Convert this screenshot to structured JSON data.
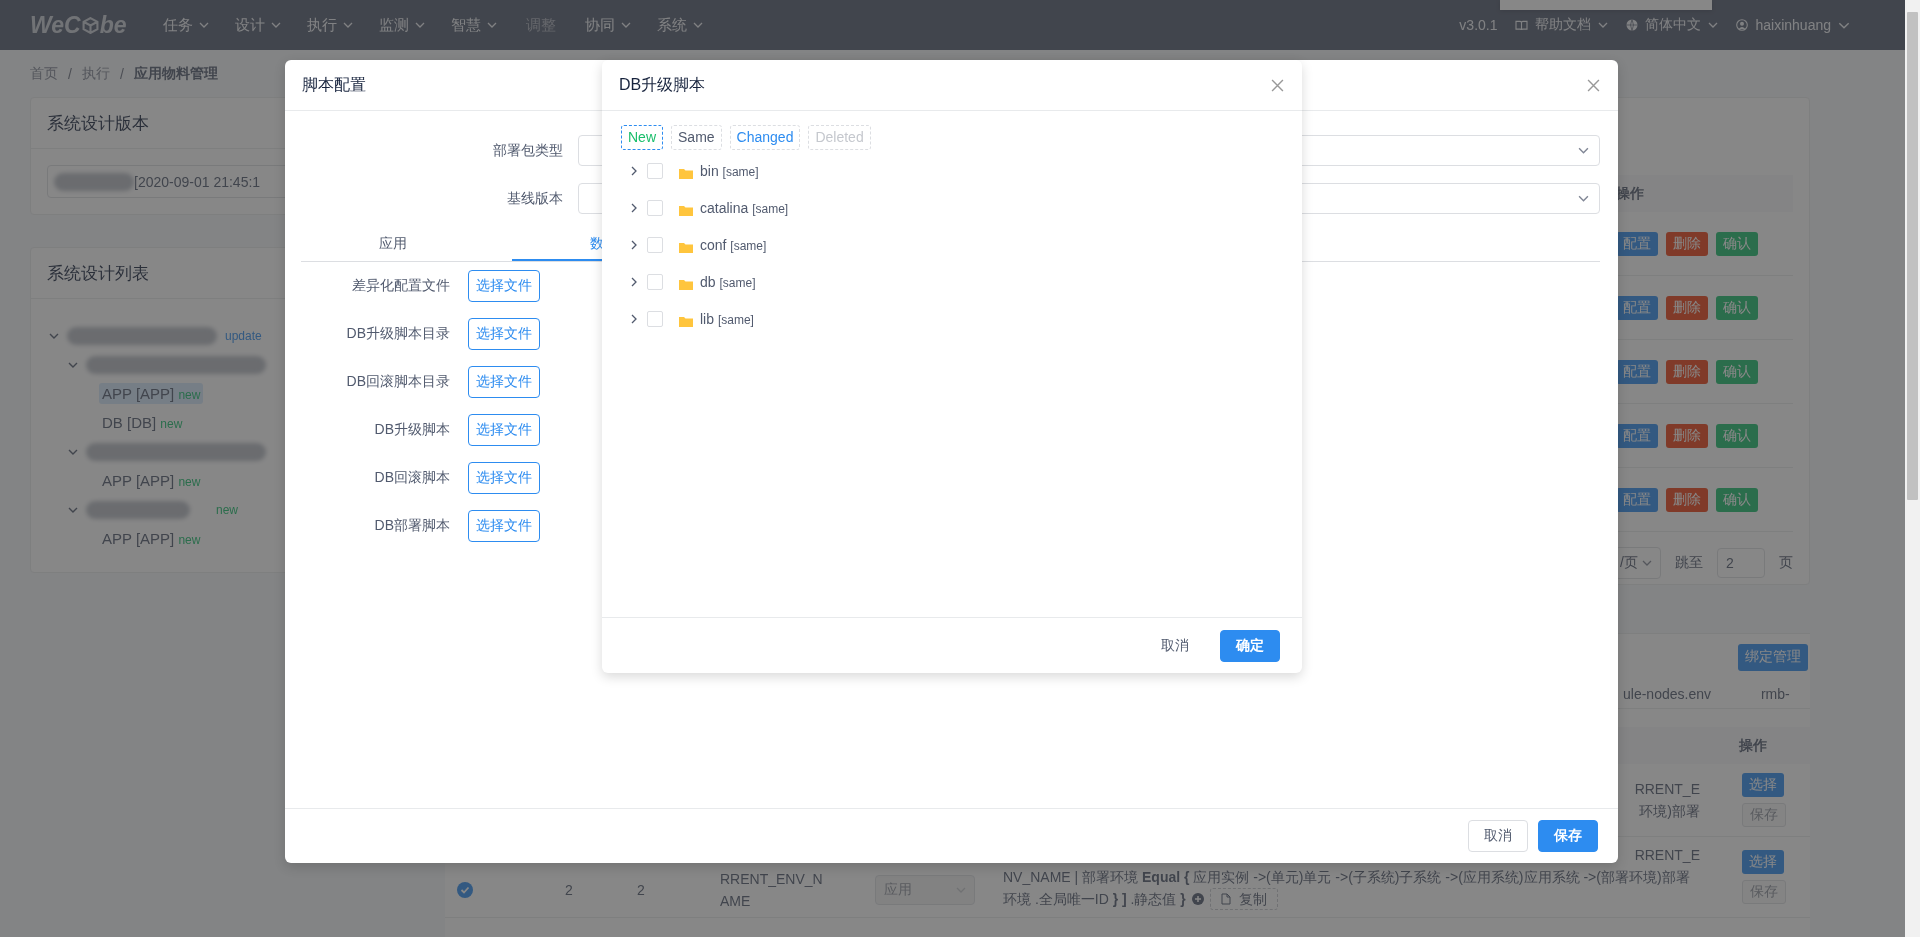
{
  "header": {
    "logo_start": "WeC",
    "logo_end": "be",
    "menu": [
      {
        "label": "任务",
        "dropdown": true,
        "disabled": false
      },
      {
        "label": "设计",
        "dropdown": true,
        "disabled": false
      },
      {
        "label": "执行",
        "dropdown": true,
        "disabled": false
      },
      {
        "label": "监测",
        "dropdown": true,
        "disabled": false
      },
      {
        "label": "智慧",
        "dropdown": true,
        "disabled": false
      },
      {
        "label": "调整",
        "dropdown": false,
        "disabled": true
      },
      {
        "label": "协同",
        "dropdown": true,
        "disabled": false
      },
      {
        "label": "系统",
        "dropdown": true,
        "disabled": false
      }
    ],
    "version": "v3.0.1",
    "help": "帮助文档",
    "language": "简体中文",
    "user": "haixinhuang"
  },
  "breadcrumb": [
    {
      "label": "首页",
      "current": false
    },
    {
      "label": "执行",
      "current": false
    },
    {
      "label": "应用物料管理",
      "current": true
    }
  ],
  "breadcrumb_separator": "/",
  "version_card": {
    "title": "系统设计版本",
    "value": "[2020-09-01 21:45:1"
  },
  "design_list": {
    "title": "系统设计列表",
    "tree": [
      {
        "kind": "redacted",
        "tag": "update",
        "color": "#335981",
        "expanded": true,
        "children": [
          {
            "kind": "redacted",
            "expanded": true,
            "children": [
              {
                "kind": "plain",
                "label": "APP [APP]",
                "tag": "new",
                "color": "#2b6d4c",
                "selected": true
              },
              {
                "kind": "plain",
                "label": "DB [DB]",
                "tag": "new",
                "color": "#2b6d4c",
                "selected": false
              }
            ]
          },
          {
            "kind": "redacted",
            "expanded": true,
            "children": [
              {
                "kind": "plain",
                "label": "APP [APP]",
                "tag": "new",
                "color": "#2b6d4c",
                "selected": false
              }
            ]
          },
          {
            "kind": "redacted",
            "tag": "new",
            "color": "#2b6d4c",
            "expanded": true,
            "children": [
              {
                "kind": "plain",
                "label": "APP [APP]",
                "tag": "new",
                "color": "#2b6d4c",
                "selected": false
              }
            ]
          }
        ]
      }
    ]
  },
  "package_table": {
    "action_header": "操作",
    "rows": [
      {
        "actions": [
          {
            "label": "配置",
            "kind": "primary"
          },
          {
            "label": "删除",
            "kind": "danger"
          },
          {
            "label": "确认",
            "kind": "success"
          }
        ]
      },
      {
        "actions": [
          {
            "label": "配置",
            "kind": "primary"
          },
          {
            "label": "删除",
            "kind": "danger"
          },
          {
            "label": "确认",
            "kind": "success"
          }
        ]
      },
      {
        "actions": [
          {
            "label": "配置",
            "kind": "primary"
          },
          {
            "label": "删除",
            "kind": "danger"
          },
          {
            "label": "确认",
            "kind": "success"
          }
        ]
      },
      {
        "actions": [
          {
            "label": "配置",
            "kind": "primary"
          },
          {
            "label": "删除",
            "kind": "danger"
          },
          {
            "label": "确认",
            "kind": "success"
          }
        ]
      },
      {
        "actions": [
          {
            "label": "配置",
            "kind": "primary"
          },
          {
            "label": "删除",
            "kind": "danger"
          },
          {
            "label": "确认",
            "kind": "success"
          }
        ]
      }
    ],
    "pagination": {
      "page_size": "/页",
      "jump_label": "跳至",
      "jump_value": "2",
      "page_unit": "页"
    }
  },
  "binding": {
    "button": "绑定管理",
    "tabs": [
      "ule-nodes.env",
      "rmb-"
    ],
    "action_header": "操作",
    "rows": [
      {
        "full": false,
        "lines": [
          {
            "text": "RRENT_E",
            "clipped": true
          },
          {
            "text": "环境)部署",
            "clipped": true
          }
        ],
        "actions": [
          {
            "label": "选择",
            "disabled": false
          },
          {
            "label": "保存",
            "disabled": true
          }
        ]
      },
      {
        "full": true,
        "checked": true,
        "col_1": "2",
        "col_2": "2",
        "col_3": "RRENT_ENV_NAME",
        "select": "应用",
        "lines": [
          {
            "text": "RRENT_E",
            "clipped": true
          },
          {
            "text": "NV_NAME | 部署环境 **Equal {** 应用实例 ->(单元)单元 ->(子系统)子系统 ->(应用系统)应用系统 ->(部署环境)部署",
            "clipped": false
          },
          {
            "text": "环境 .全局唯一ID **} ]** .静态值 **}**",
            "clipped": false
          }
        ],
        "copy": "复制",
        "actions": [
          {
            "label": "选择",
            "disabled": false
          },
          {
            "label": "保存",
            "disabled": true
          }
        ]
      }
    ]
  },
  "script_dialog": {
    "title": "脚本配置",
    "selects": [
      {
        "label": "部署包类型"
      },
      {
        "label": "基线版本"
      }
    ],
    "tabs": [
      {
        "label": "应用",
        "selected": false
      },
      {
        "label": "数",
        "selected": true
      }
    ],
    "file_rows": [
      {
        "label": "差异化配置文件",
        "button": "选择文件"
      },
      {
        "label": "DB升级脚本目录",
        "button": "选择文件"
      },
      {
        "label": "DB回滚脚本目录",
        "button": "选择文件"
      },
      {
        "label": "DB升级脚本",
        "button": "选择文件"
      },
      {
        "label": "DB回滚脚本",
        "button": "选择文件"
      },
      {
        "label": "DB部署脚本",
        "button": "选择文件"
      }
    ],
    "cancel": "取消",
    "save": "保存"
  },
  "upgrade_dialog": {
    "title": "DB升级脚本",
    "filters": [
      {
        "label": "New",
        "color": "#19be6b",
        "selected": true
      },
      {
        "label": "Same",
        "color": "#515a6e",
        "selected": false
      },
      {
        "label": "Changed",
        "color": "#2d8cf0",
        "selected": false
      },
      {
        "label": "Deleted",
        "color": "#c5c8ce",
        "selected": false
      }
    ],
    "tree": [
      {
        "name": "bin",
        "tag": "[same]",
        "checked": false,
        "expanded": false
      },
      {
        "name": "catalina",
        "tag": "[same]",
        "checked": false,
        "expanded": false
      },
      {
        "name": "conf",
        "tag": "[same]",
        "checked": false,
        "expanded": false
      },
      {
        "name": "db",
        "tag": "[same]",
        "checked": false,
        "expanded": false
      },
      {
        "name": "lib",
        "tag": "[same]",
        "checked": false,
        "expanded": false
      }
    ],
    "cancel": "取消",
    "ok": "确定"
  }
}
